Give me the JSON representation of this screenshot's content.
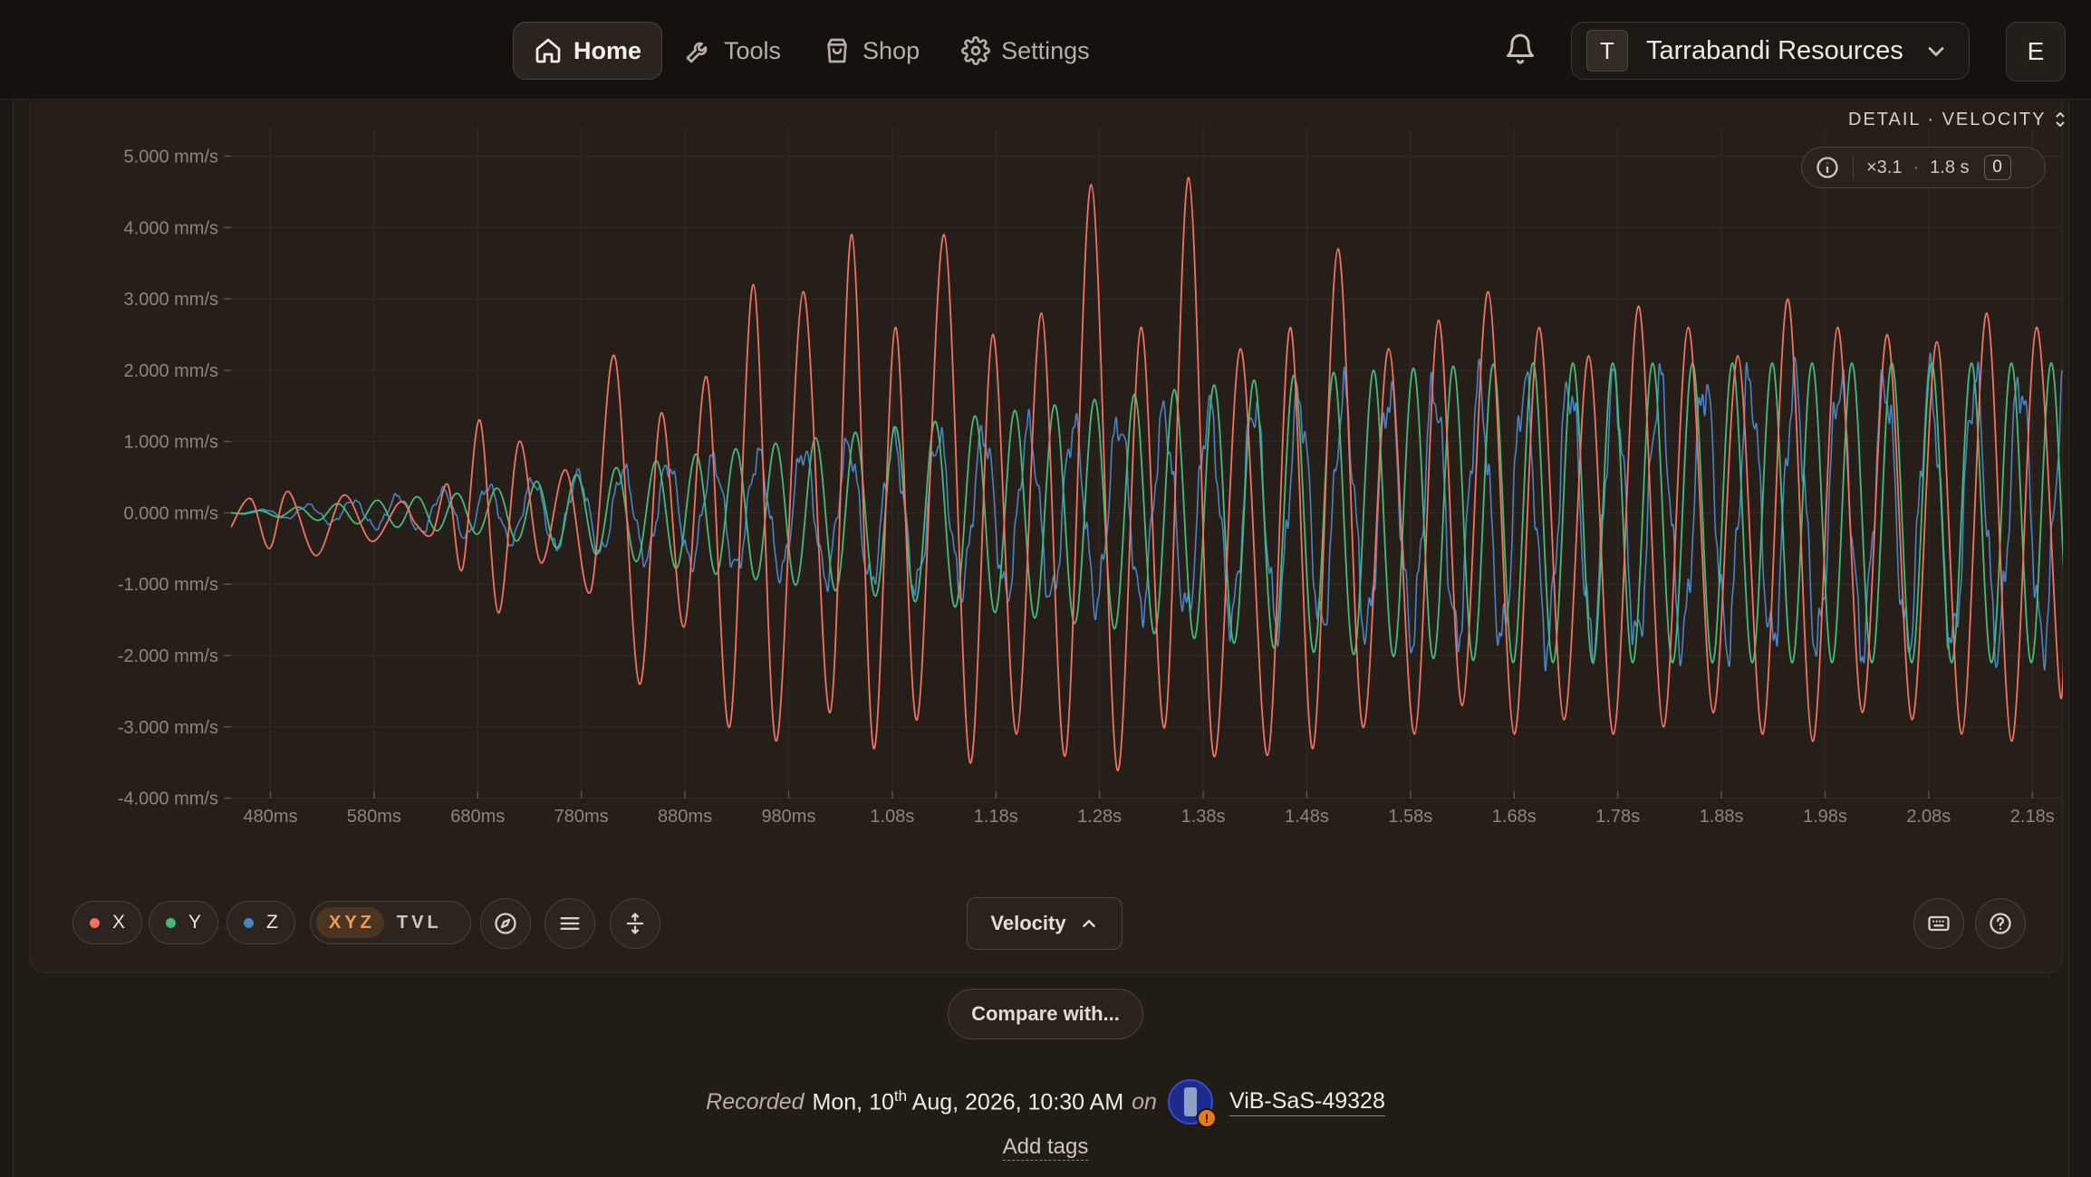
{
  "nav": {
    "items": [
      {
        "label": "Home",
        "icon": "home-icon",
        "active": true
      },
      {
        "label": "Tools",
        "icon": "wrench-icon",
        "active": false
      },
      {
        "label": "Shop",
        "icon": "shopping-bag-icon",
        "active": false
      },
      {
        "label": "Settings",
        "icon": "gear-icon",
        "active": false
      }
    ],
    "org": {
      "initial": "T",
      "name": "Tarrabandi Resources"
    },
    "user_initial": "E"
  },
  "chart_header": {
    "detail_label": "DETAIL · VELOCITY",
    "zoom_factor": "×3.1",
    "zoom_separator": "·",
    "window": "1.8 s",
    "marker_count": "0"
  },
  "chart_data": {
    "type": "line",
    "x_unit": "ms",
    "xlim": [
      442,
      2213
    ],
    "ylim": [
      -4500,
      5400
    ],
    "y_unit": "mm/s",
    "y_ticks": [
      5000,
      4000,
      3000,
      2000,
      1000,
      0,
      -1000,
      -2000,
      -3000,
      -4000
    ],
    "y_tick_labels": [
      "5.000 mm/s",
      "4.000 mm/s",
      "3.000 mm/s",
      "2.000 mm/s",
      "1.000 mm/s",
      "0.000 mm/s",
      "-1.000 mm/s",
      "-2.000 mm/s",
      "-3.000 mm/s",
      "-4.000 mm/s"
    ],
    "x_ticks": [
      480,
      580,
      680,
      780,
      880,
      980,
      1080,
      1180,
      1280,
      1380,
      1480,
      1580,
      1680,
      1780,
      1880,
      1980,
      2080,
      2180
    ],
    "x_tick_labels": [
      "480ms",
      "580ms",
      "680ms",
      "780ms",
      "880ms",
      "980ms",
      "1.08s",
      "1.18s",
      "1.28s",
      "1.38s",
      "1.48s",
      "1.58s",
      "1.68s",
      "1.78s",
      "1.88s",
      "1.98s",
      "2.08s",
      "2.18s"
    ],
    "grid": true,
    "series": [
      {
        "name": "X",
        "color": "#f0735f",
        "x": [
          442,
          461,
          479,
          497,
          524,
          551,
          578,
          605,
          620,
          636,
          651,
          665,
          682,
          700,
          720,
          741,
          765,
          789,
          812,
          836,
          857,
          879,
          901,
          923,
          946,
          968,
          994,
          1020,
          1041,
          1062,
          1083,
          1104,
          1130,
          1155,
          1177,
          1200,
          1224,
          1247,
          1272,
          1297,
          1320,
          1343,
          1366,
          1390,
          1416,
          1442,
          1464,
          1486,
          1510,
          1534,
          1559,
          1584,
          1607,
          1630,
          1655,
          1680,
          1704,
          1728,
          1752,
          1776,
          1800,
          1824,
          1848,
          1872,
          1896,
          1920,
          1944,
          1968,
          1992,
          2016,
          2040,
          2064,
          2088,
          2112,
          2136,
          2160,
          2184,
          2208,
          2213
        ],
        "values": [
          -200,
          200,
          -500,
          300,
          -600,
          250,
          -400,
          150,
          -150,
          -300,
          400,
          -800,
          1300,
          -1400,
          1000,
          -700,
          600,
          -1100,
          2200,
          -2400,
          1400,
          -1600,
          1900,
          -3000,
          3200,
          -3200,
          3100,
          -2800,
          3900,
          -3300,
          2600,
          -2900,
          3900,
          -3500,
          2500,
          -3100,
          2800,
          -3400,
          4600,
          -3600,
          2600,
          -3000,
          4700,
          -3400,
          2300,
          -3400,
          2600,
          -3300,
          3700,
          -3000,
          2300,
          -3100,
          2700,
          -2700,
          3100,
          -3100,
          2600,
          -2900,
          2200,
          -3100,
          2900,
          -3000,
          2600,
          -2800,
          2200,
          -3100,
          3000,
          -3200,
          2600,
          -2800,
          2500,
          -2900,
          2400,
          -3100,
          2800,
          -3200,
          2600,
          -2600,
          3500
        ],
        "line_width": 1.8
      },
      {
        "name": "Y",
        "color": "#45b97a",
        "amplitudes": [
          [
            442,
            0
          ],
          [
            680,
            300
          ],
          [
            880,
            800
          ],
          [
            1080,
            1200
          ],
          [
            1280,
            1600
          ],
          [
            1480,
            1950
          ],
          [
            1680,
            2100
          ],
          [
            2213,
            2100
          ]
        ],
        "frequency_hz": 26,
        "phase": 0.6,
        "line_width": 1.8
      },
      {
        "name": "Z",
        "color": "#4a82c2",
        "amplitudes": [
          [
            442,
            0
          ],
          [
            680,
            350
          ],
          [
            880,
            700
          ],
          [
            1080,
            1000
          ],
          [
            1280,
            1250
          ],
          [
            1480,
            1600
          ],
          [
            1680,
            1800
          ],
          [
            2213,
            1850
          ]
        ],
        "frequency_hz": 23,
        "phase": 2.4,
        "line_width": 1.6
      }
    ]
  },
  "toolbar": {
    "series_chips": [
      {
        "label": "X",
        "color": "#f0735f"
      },
      {
        "label": "Y",
        "color": "#45b97a"
      },
      {
        "label": "Z",
        "color": "#4a82c2"
      }
    ],
    "mode_active": "XYZ",
    "mode_other": "TVL",
    "measure_label": "Velocity",
    "icons": [
      "compass-icon",
      "menu-lines-icon",
      "move-arrows-icon",
      "keyboard-icon",
      "help-circle-icon"
    ]
  },
  "compare_label": "Compare with...",
  "recording": {
    "recorded_word": "Recorded",
    "date_prefix": "Mon, 10",
    "date_sup": "th",
    "date_suffix": " Aug, 2026, 10:30 AM",
    "on_word": "on",
    "device_name": "ViB-SaS-49328",
    "device_alert": "!"
  },
  "add_tags_label": "Add tags"
}
